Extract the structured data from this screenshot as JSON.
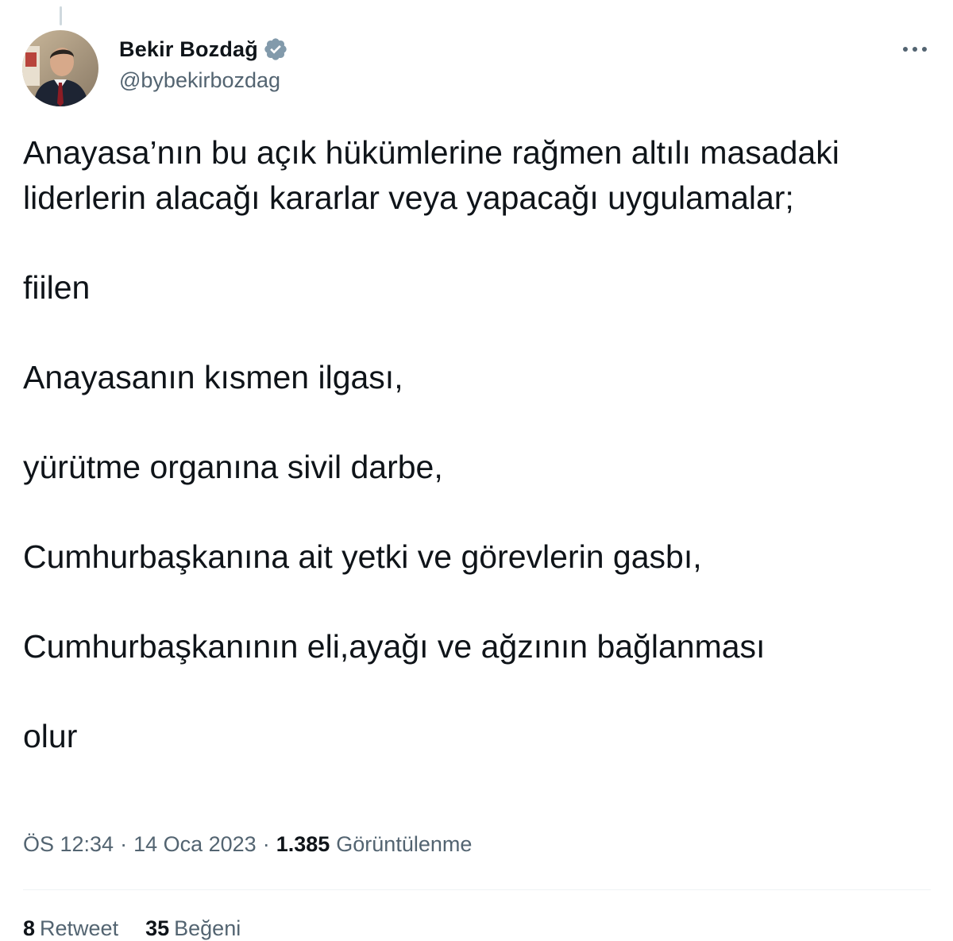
{
  "author": {
    "display_name": "Bekir Bozdağ",
    "handle": "@bybekirbozdag",
    "verified": true
  },
  "tweet": {
    "paragraphs": [
      "Anayasa’nın bu açık hükümlerine rağmen altılı masadaki liderlerin alacağı kararlar veya yapacağı uygulamalar;",
      "fiilen",
      "Anayasanın kısmen ilgası,",
      "yürütme organına sivil darbe,",
      "Cumhurbaşkanına ait yetki ve görevlerin gasbı,",
      "Cumhurbaşkanının eli,ayağı ve ağzının bağlanması",
      "olur"
    ]
  },
  "meta": {
    "time": "ÖS 12:34",
    "separator": "·",
    "date": "14 Oca 2023",
    "view_count": "1.385",
    "views_label": "Görüntülenme"
  },
  "stats": {
    "retweets_count": "8",
    "retweets_label": "Retweet",
    "likes_count": "35",
    "likes_label": "Beğeni"
  },
  "icons": {
    "more": "more-horizontal-icon",
    "verified": "verified-badge-icon"
  },
  "colors": {
    "text_primary": "#0f1419",
    "text_secondary": "#536471",
    "verified_badge": "#829aab",
    "divider": "#eff3f4"
  }
}
